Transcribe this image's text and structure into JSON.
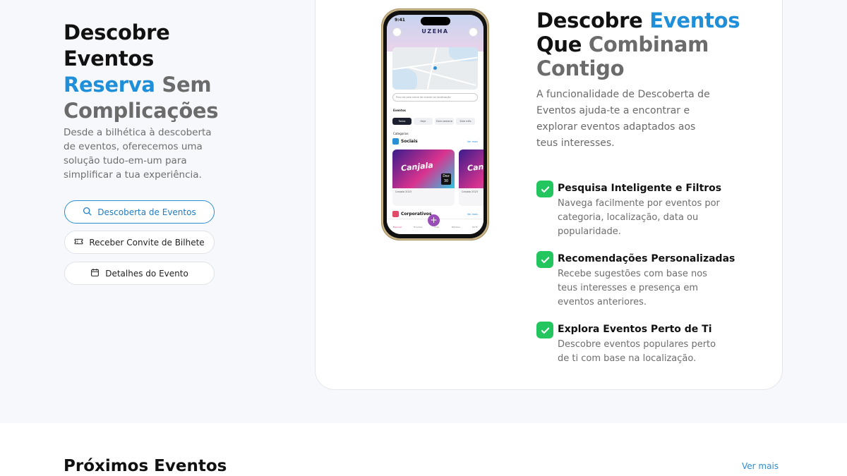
{
  "hero": {
    "title_line1": "Descobre",
    "title_line2": "Eventos",
    "title_line3_blue": "Reserva",
    "title_line3_grey": "Sem",
    "title_line4": "Complicações",
    "description": "Desde a bilhética à descoberta de eventos, oferecemos uma solução tudo-em-um para simplificar a tua experiência."
  },
  "nav_buttons": [
    {
      "label": "Descoberta de Eventos",
      "icon": "search-icon",
      "active": true
    },
    {
      "label": "Receber Convite de Bilhete",
      "icon": "ticket-icon",
      "active": false
    },
    {
      "label": "Detalhes do Evento",
      "icon": "calendar-icon",
      "active": false
    }
  ],
  "phone": {
    "time": "9:41",
    "app_name": "UZEHA",
    "search_placeholder": "Procura pelo nome do evento ou localização",
    "events_label": "Eventos",
    "chips": [
      "Todos",
      "Hoje",
      "Esta semana",
      "Este mês"
    ],
    "categories_label": "Categorias",
    "section1": "Sociais",
    "section2": "Corporativos",
    "see_more": "Ver mais",
    "event_image_text": "Canjala",
    "event_name": "Canjala 2023",
    "event_day": "30",
    "event_weekday": "Dez",
    "tabs": [
      "Explorar",
      "Eventos",
      "Criar",
      "Bilhetes",
      "Perfil"
    ]
  },
  "feature": {
    "title_blk": "Descobre",
    "title_blue": "Eventos",
    "title_blk2": "Que",
    "title_grey": "Combinam Contigo",
    "description": "A funcionalidade de Descoberta de Eventos ajuda-te a encontrar e explorar eventos adaptados aos teus interesses.",
    "items": [
      {
        "title": "Pesquisa Inteligente e Filtros",
        "desc": "Navega facilmente por eventos por categoria, localização, data ou popularidade."
      },
      {
        "title": "Recomendações Personalizadas",
        "desc": "Recebe sugestões com base nos teus interesses e presença em eventos anteriores."
      },
      {
        "title": "Explora Eventos Perto de Ti",
        "desc": "Descobre eventos populares perto de ti com base na localização."
      }
    ]
  },
  "upcoming": {
    "title": "Próximos Eventos",
    "see_more": "Ver mais"
  },
  "colors": {
    "accent": "#1f8fd9",
    "check": "#22c55e",
    "muted_text": "#6e6e6e"
  }
}
